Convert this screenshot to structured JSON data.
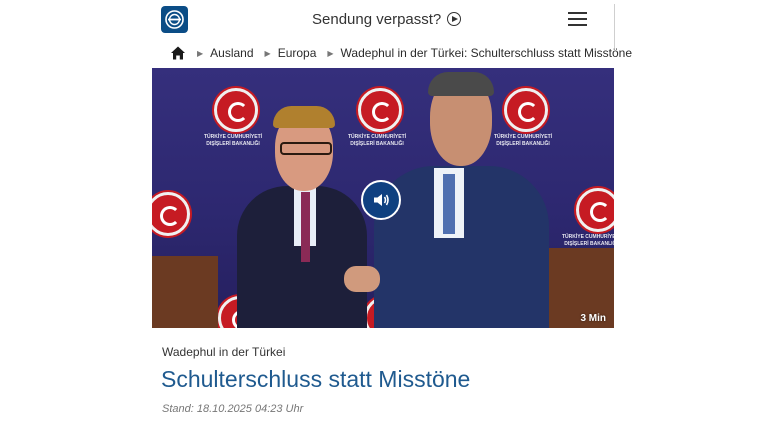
{
  "header": {
    "logo_icon": "tagesschau-logo-icon",
    "sendung_label": "Sendung verpasst?",
    "play_icon": "play-circle-icon",
    "menu_icon": "hamburger-menu-icon"
  },
  "breadcrumb": {
    "home_icon": "home-icon",
    "items": [
      {
        "label": "Ausland"
      },
      {
        "label": "Europa"
      },
      {
        "label": "Wadephul in der Türkei: Schulterschluss statt Misstöne"
      }
    ]
  },
  "media": {
    "sound_icon": "speaker-icon",
    "duration": "3 Min",
    "emblem_caption": "TÜRKİYE CUMHURİYETİ DIŞİŞLERİ BAKANLIĞI"
  },
  "article": {
    "topline": "Wadephul in der Türkei",
    "headline": "Schulterschluss statt Misstöne",
    "stand": "Stand: 18.10.2025 04:23 Uhr"
  },
  "colors": {
    "brand_blue": "#0b4d86",
    "headline_blue": "#1f5a8f",
    "backdrop_purple": "#2d2870",
    "emblem_red": "#c61b23"
  }
}
